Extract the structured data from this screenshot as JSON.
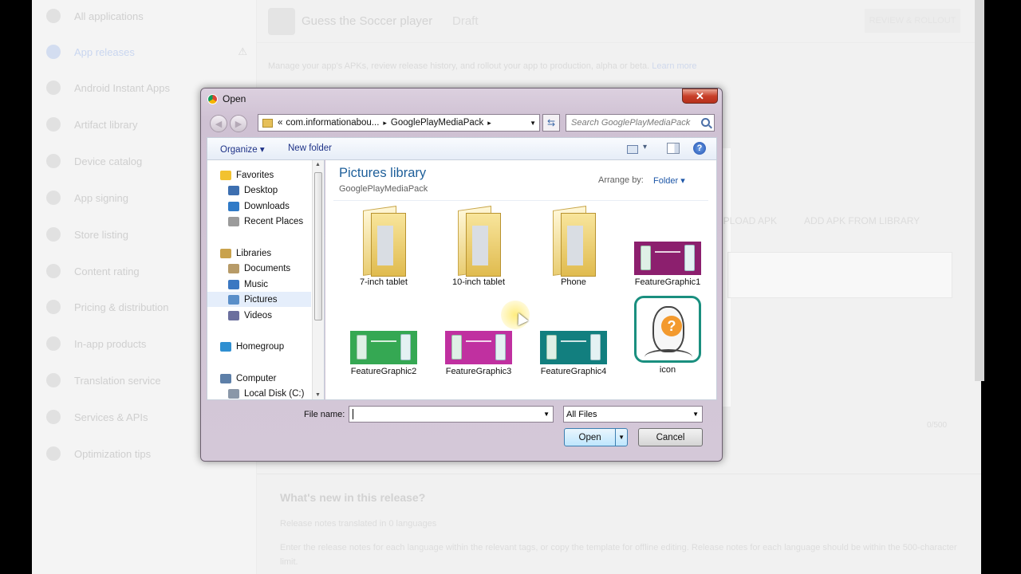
{
  "background": {
    "sidebar": {
      "items": [
        {
          "label": "All applications"
        },
        {
          "label": "App releases"
        },
        {
          "label": "Android Instant Apps"
        },
        {
          "label": "Artifact library"
        },
        {
          "label": "Device catalog"
        },
        {
          "label": "App signing"
        },
        {
          "label": "Store listing"
        },
        {
          "label": "Content rating"
        },
        {
          "label": "Pricing & distribution"
        },
        {
          "label": "In-app products"
        },
        {
          "label": "Translation service"
        },
        {
          "label": "Services & APIs"
        },
        {
          "label": "Optimization tips"
        }
      ],
      "warning_icon": "⚠"
    },
    "header": {
      "app_title": "Guess the Soccer player",
      "status": "Draft",
      "review_button": "REVIEW & ROLLOUT"
    },
    "description": "Manage your app's APKs, review release history, and rollout your app to production, alpha or beta.",
    "learn_more": "Learn more",
    "upload_apk": "UPLOAD APK",
    "add_from_library": "ADD APK FROM LIBRARY",
    "el_text": "EL",
    "char_count": "0/500",
    "whats_new_title": "What's new in this release?",
    "translations": "Release notes translated in 0 languages",
    "notes_help": "Enter the release notes for each language within the relevant tags, or copy the template for offline editing. Release notes for each language should be within the 500-character limit."
  },
  "dialog": {
    "title": "Open",
    "close_glyph": "✕",
    "address": {
      "prefix": "«",
      "segments": [
        "com.informationabou...",
        "GooglePlayMediaPack"
      ],
      "separator": "▸"
    },
    "search_placeholder": "Search GooglePlayMediaPack",
    "toolbar": {
      "organize": "Organize ▾",
      "new_folder": "New folder",
      "views_glyph": "▾",
      "help_glyph": "?"
    },
    "nav": {
      "items": [
        {
          "label": "Favorites",
          "color": "#f2c230"
        },
        {
          "label": "Desktop",
          "color": "#3d6fb0"
        },
        {
          "label": "Downloads",
          "color": "#2f7ac7"
        },
        {
          "label": "Recent Places",
          "color": "#9b9b9b"
        },
        {
          "label": "Libraries",
          "color": "#c9a24c"
        },
        {
          "label": "Documents",
          "color": "#b79b68"
        },
        {
          "label": "Music",
          "color": "#3b78c2"
        },
        {
          "label": "Pictures",
          "color": "#5a8fc9"
        },
        {
          "label": "Videos",
          "color": "#6b6f9e"
        },
        {
          "label": "Homegroup",
          "color": "#2f8fd1"
        },
        {
          "label": "Computer",
          "color": "#5d7fa8"
        },
        {
          "label": "Local Disk (C:)",
          "color": "#8a97a8"
        }
      ]
    },
    "library_title": "Pictures library",
    "library_subtitle": "GooglePlayMediaPack",
    "arrange_by_label": "Arrange by:",
    "arrange_by_value": "Folder ▾",
    "files": [
      {
        "name": "7-inch tablet",
        "kind": "folder"
      },
      {
        "name": "10-inch tablet",
        "kind": "folder"
      },
      {
        "name": "Phone",
        "kind": "folder"
      },
      {
        "name": "FeatureGraphic1",
        "kind": "image",
        "color": "#8c1f6e"
      },
      {
        "name": "FeatureGraphic2",
        "kind": "image",
        "color": "#35a853"
      },
      {
        "name": "FeatureGraphic3",
        "kind": "image",
        "color": "#c030a0"
      },
      {
        "name": "FeatureGraphic4",
        "kind": "image",
        "color": "#127f7f"
      },
      {
        "name": "icon",
        "kind": "icon"
      }
    ],
    "icon_glyph": "?",
    "file_name_label": "File name:",
    "file_name_value": "",
    "filter_value": "All Files",
    "open_button": "Open",
    "cancel_button": "Cancel"
  }
}
